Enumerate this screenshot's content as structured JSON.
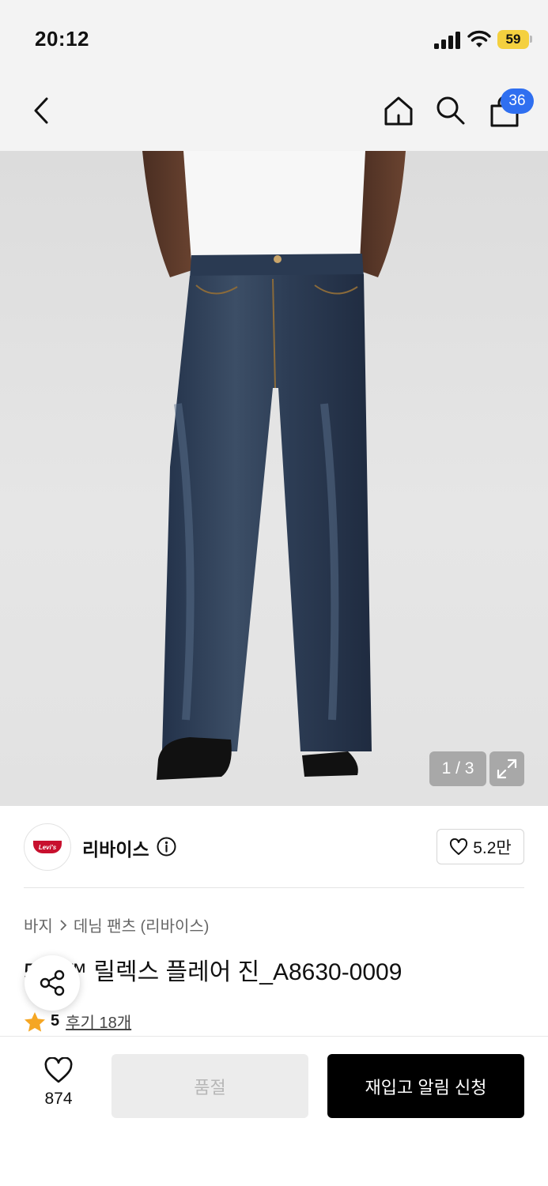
{
  "status_bar": {
    "time": "20:12",
    "battery": "59",
    "icons": [
      "signal-icon",
      "wifi-icon",
      "battery-icon"
    ]
  },
  "nav": {
    "icons": [
      "back-icon",
      "home-icon",
      "search-icon",
      "shopping-bag-icon"
    ],
    "cart_count": "36"
  },
  "gallery": {
    "counter": "1 / 3",
    "expand_icon": "expand-icon"
  },
  "brand": {
    "name": "리바이스",
    "logo_text": "Levi's",
    "likes": "5.2만"
  },
  "product": {
    "breadcrumb": [
      "바지",
      "데님 팬츠 (리바이스)"
    ],
    "title": "578™ 릴렉스 플레어 진_A8630-0009",
    "rating": "5",
    "reviews": "후기 18개"
  },
  "bottom": {
    "wish_count": "874",
    "soldout_label": "품절",
    "restock_label": "재입고 알림 신청"
  },
  "colors": {
    "accent_badge": "#2f6ff0",
    "battery": "#f4d03f",
    "star": "#f5a623",
    "primary_button": "#000000"
  }
}
